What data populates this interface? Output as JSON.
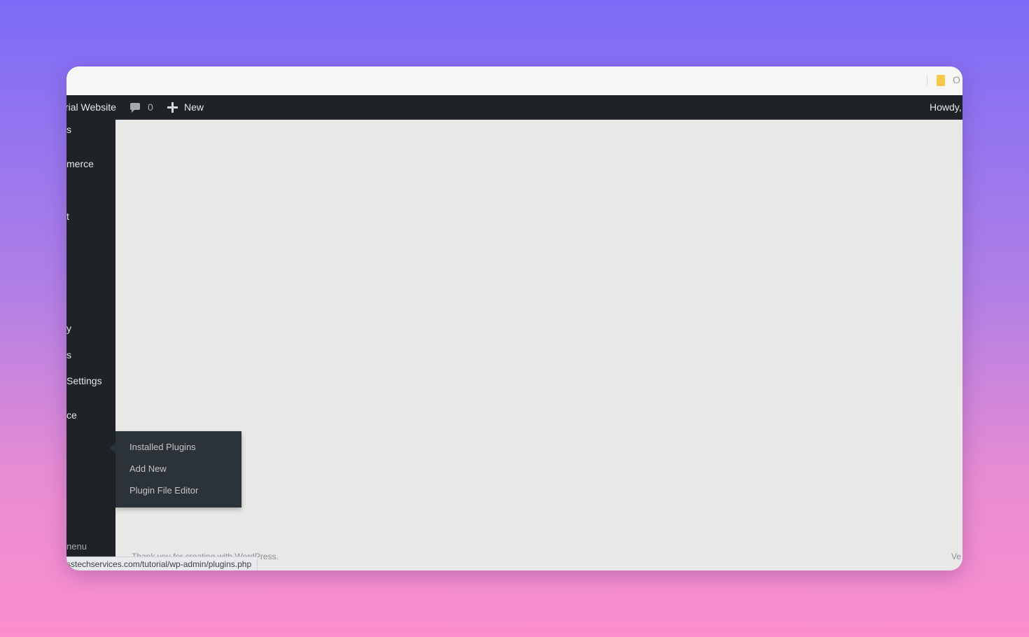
{
  "browser": {
    "tail_text": "O"
  },
  "admin_bar": {
    "site_name": "rial Website",
    "comment_count": "0",
    "new_label": "New",
    "howdy": "Howdy,"
  },
  "sidebar": {
    "items": [
      {
        "label": "s"
      },
      {
        "label": "merce"
      },
      {
        "label": "t"
      },
      {
        "label": "y"
      },
      {
        "label": "s"
      },
      {
        "label": " Settings"
      },
      {
        "label": "ce"
      },
      {
        "label": "nenu"
      }
    ]
  },
  "plugins_flyout": {
    "items": [
      {
        "label": "Installed Plugins"
      },
      {
        "label": "Add New"
      },
      {
        "label": "Plugin File Editor"
      }
    ]
  },
  "footer": {
    "thanks": "Thank you for creating with WordPress.",
    "version": "Ve"
  },
  "status_bar": {
    "url": "sstechservices.com/tutorial/wp-admin/plugins.php"
  }
}
